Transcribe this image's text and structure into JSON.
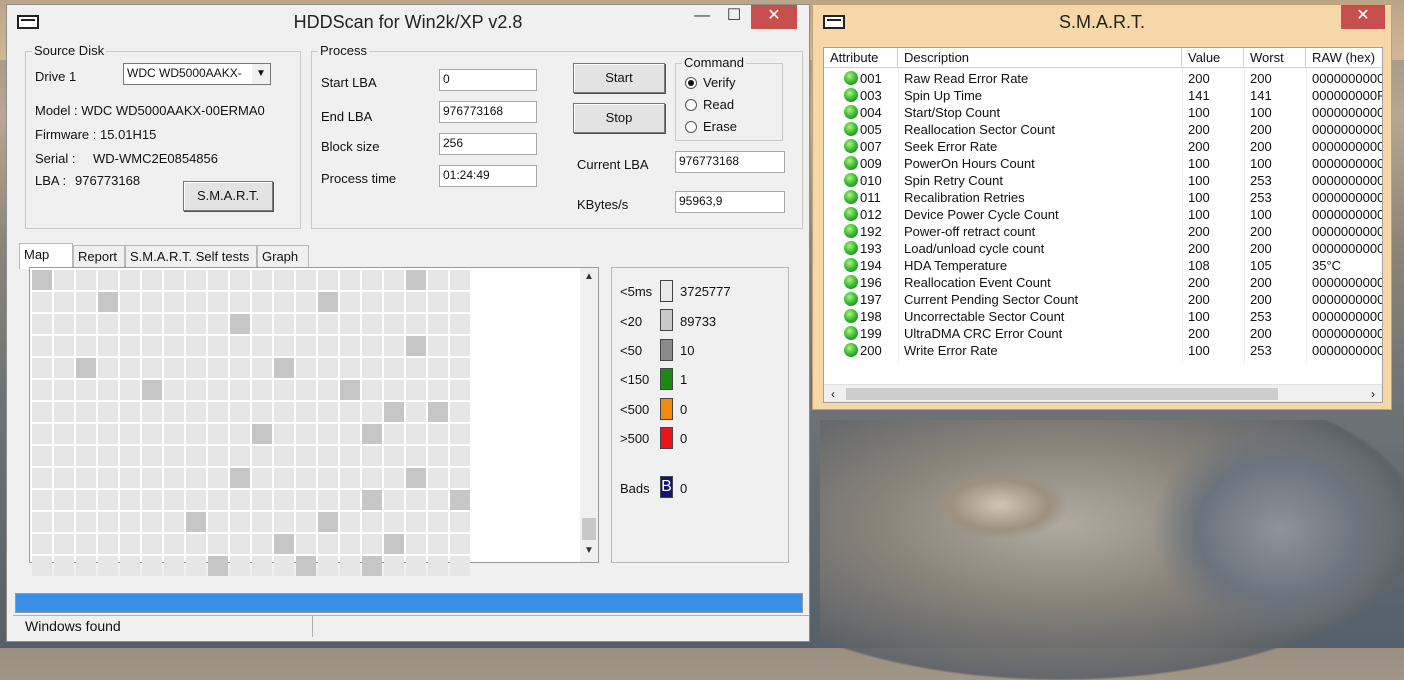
{
  "main_window": {
    "title": "HDDScan for Win2k/XP  v2.8",
    "source_disk": {
      "group_label": "Source Disk",
      "drive_label": "Drive  1",
      "drive_select": "WDC WD5000AAKX-",
      "model": "Model : WDC WD5000AAKX-00ERMA0",
      "firmware": "Firmware : 15.01H15",
      "serial_label": "Serial :",
      "serial_value": "WD-WMC2E0854856",
      "lba_label": "LBA :",
      "lba_value": "976773168",
      "smart_button": "S.M.A.R.T."
    },
    "process": {
      "group_label": "Process",
      "start_lba_label": "Start LBA",
      "start_lba_value": "0",
      "end_lba_label": "End LBA",
      "end_lba_value": "976773168",
      "block_size_label": "Block size",
      "block_size_value": "256",
      "process_time_label": "Process time",
      "process_time_value": "01:24:49",
      "start_button": "Start",
      "stop_button": "Stop",
      "current_lba_label": "Current LBA",
      "current_lba_value": "976773168",
      "kbytes_label": "KBytes/s",
      "kbytes_value": "95963,9"
    },
    "command": {
      "group_label": "Command",
      "options": [
        "Verify",
        "Read",
        "Erase"
      ],
      "selected": "Verify"
    },
    "tabs": [
      "Map",
      "Report",
      "S.M.A.R.T. Self tests",
      "Graph"
    ],
    "active_tab": "Map",
    "legend": [
      {
        "label": "<5ms",
        "value": "3725777",
        "color": "#e8e8e8"
      },
      {
        "label": "<20",
        "value": "89733",
        "color": "#c8c8c8"
      },
      {
        "label": "<50",
        "value": "10",
        "color": "#8a8a8a"
      },
      {
        "label": "<150",
        "value": "1",
        "color": "#1a8a12"
      },
      {
        "label": "<500",
        "value": "0",
        "color": "#f08a10"
      },
      {
        "label": ">500",
        "value": "0",
        "color": "#e8141a"
      }
    ],
    "bads": {
      "label": "Bads",
      "icon_text": "B",
      "value": "0",
      "color": "#14146e"
    },
    "progress_fraction": 1.0,
    "status_text": "Windows  found"
  },
  "smart_window": {
    "title": "S.M.A.R.T.",
    "columns": [
      "Attribute",
      "Description",
      "Value",
      "Worst",
      "RAW (hex)"
    ],
    "rows": [
      [
        "001",
        "Raw Read Error Rate",
        "200",
        "200",
        "0000000000"
      ],
      [
        "003",
        "Spin Up Time",
        "141",
        "141",
        "000000000F"
      ],
      [
        "004",
        "Start/Stop Count",
        "100",
        "100",
        "0000000000"
      ],
      [
        "005",
        "Reallocation Sector Count",
        "200",
        "200",
        "0000000000"
      ],
      [
        "007",
        "Seek Error Rate",
        "200",
        "200",
        "0000000000"
      ],
      [
        "009",
        "PowerOn Hours Count",
        "100",
        "100",
        "0000000000"
      ],
      [
        "010",
        "Spin Retry Count",
        "100",
        "253",
        "0000000000"
      ],
      [
        "011",
        "Recalibration Retries",
        "100",
        "253",
        "0000000000"
      ],
      [
        "012",
        "Device Power Cycle Count",
        "100",
        "100",
        "0000000000"
      ],
      [
        "192",
        "Power-off retract count",
        "200",
        "200",
        "0000000000"
      ],
      [
        "193",
        "Load/unload cycle count",
        "200",
        "200",
        "0000000000"
      ],
      [
        "194",
        "HDA Temperature",
        "108",
        "105",
        "35°C"
      ],
      [
        "196",
        "Reallocation Event Count",
        "200",
        "200",
        "0000000000"
      ],
      [
        "197",
        "Current Pending Sector Count",
        "200",
        "200",
        "0000000000"
      ],
      [
        "198",
        "Uncorrectable Sector Count",
        "100",
        "253",
        "0000000000"
      ],
      [
        "199",
        "UltraDMA CRC Error Count",
        "200",
        "200",
        "0000000000"
      ],
      [
        "200",
        "Write Error Rate",
        "100",
        "253",
        "0000000000"
      ]
    ],
    "status_color": "#3ec23a"
  }
}
